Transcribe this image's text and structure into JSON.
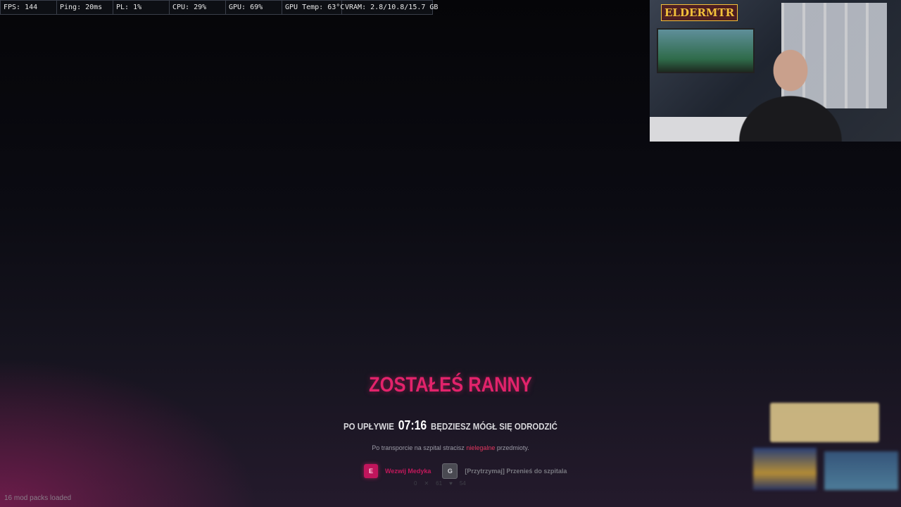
{
  "stats": {
    "fps": "FPS: 144",
    "ping": "Ping: 20ms",
    "pl": "PL: 1%",
    "cpu": "CPU: 29%",
    "gpu": "GPU: 69%",
    "gpu_temp": "GPU Temp: 63°C",
    "vram": "VRAM: 2.8/10.8/15.7 GB"
  },
  "webcam": {
    "logo_text": "ELDERMTR"
  },
  "death_screen": {
    "title": "ZOSTAŁEŚ RANNY",
    "respawn_prefix": "PO UPŁYWIE",
    "respawn_timer": "07:16",
    "respawn_suffix": "BĘDZIESZ MÓGŁ SIĘ ODRODZIĆ",
    "transport_prefix": "Po transporcie na szpital stracisz",
    "transport_highlight": "nielegalne",
    "transport_suffix": "przedmioty.",
    "action_primary_key": "E",
    "action_primary_label": "Wezwij Medyka",
    "action_secondary_key": "G",
    "action_secondary_label": "[Przytrzymaj] Przenieś do szpitala",
    "status_values": [
      "0",
      "61",
      "54"
    ]
  },
  "footer": {
    "mod_packs": "16 mod packs loaded"
  },
  "colors": {
    "accent": "#e2236b",
    "illegal": "#e2365f",
    "background": "#0b0b12"
  }
}
